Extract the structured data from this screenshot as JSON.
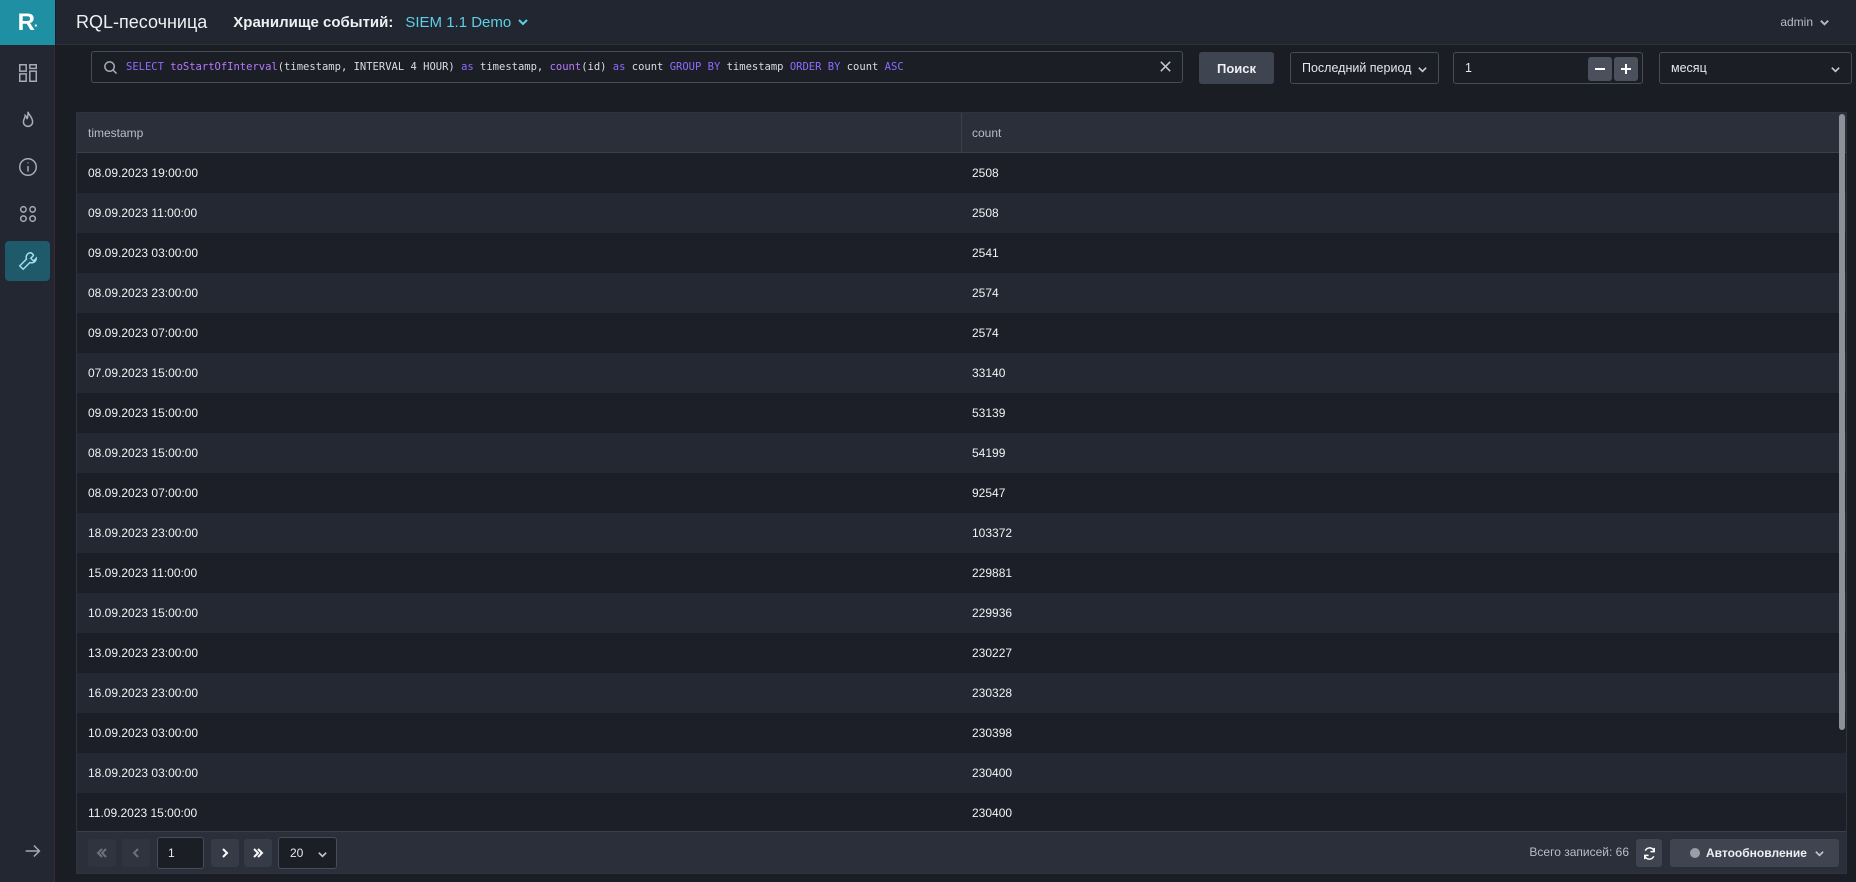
{
  "brand": {
    "logo_letter": "R",
    "logo_dot": "·"
  },
  "header": {
    "title": "RQL-песочница",
    "storage_label": "Хранилище событий:",
    "storage_value": "SIEM 1.1 Demo",
    "user": "admin"
  },
  "sidebar": {
    "items": [
      {
        "icon": "dashboard-icon"
      },
      {
        "icon": "flame-icon"
      },
      {
        "icon": "info-icon"
      },
      {
        "icon": "apps-icon"
      },
      {
        "icon": "wrench-icon",
        "active": true
      }
    ],
    "expand_icon": "arrow-right-icon"
  },
  "toolbar": {
    "query_tokens": [
      {
        "t": "SELECT ",
        "k": "kw"
      },
      {
        "t": "toStartOfInterval",
        "k": "fn"
      },
      {
        "t": "(timestamp, INTERVAL 4 HOUR) ",
        "k": ""
      },
      {
        "t": "as ",
        "k": "kw"
      },
      {
        "t": "timestamp, ",
        "k": ""
      },
      {
        "t": "count",
        "k": "fn"
      },
      {
        "t": "(id) ",
        "k": ""
      },
      {
        "t": "as ",
        "k": "kw"
      },
      {
        "t": "count ",
        "k": ""
      },
      {
        "t": "GROUP BY ",
        "k": "kw"
      },
      {
        "t": "timestamp ",
        "k": ""
      },
      {
        "t": "ORDER BY ",
        "k": "kw"
      },
      {
        "t": "count ",
        "k": ""
      },
      {
        "t": "ASC",
        "k": "kw"
      }
    ],
    "search_button": "Поиск",
    "period_select": "Последний период",
    "period_value": "1",
    "unit_select": "месяц"
  },
  "table": {
    "columns": [
      "timestamp",
      "count"
    ],
    "rows": [
      [
        "08.09.2023 19:00:00",
        "2508"
      ],
      [
        "09.09.2023 11:00:00",
        "2508"
      ],
      [
        "09.09.2023 03:00:00",
        "2541"
      ],
      [
        "08.09.2023 23:00:00",
        "2574"
      ],
      [
        "09.09.2023 07:00:00",
        "2574"
      ],
      [
        "07.09.2023 15:00:00",
        "33140"
      ],
      [
        "09.09.2023 15:00:00",
        "53139"
      ],
      [
        "08.09.2023 15:00:00",
        "54199"
      ],
      [
        "08.09.2023 07:00:00",
        "92547"
      ],
      [
        "18.09.2023 23:00:00",
        "103372"
      ],
      [
        "15.09.2023 11:00:00",
        "229881"
      ],
      [
        "10.09.2023 15:00:00",
        "229936"
      ],
      [
        "13.09.2023 23:00:00",
        "230227"
      ],
      [
        "16.09.2023 23:00:00",
        "230328"
      ],
      [
        "10.09.2023 03:00:00",
        "230398"
      ],
      [
        "18.09.2023 03:00:00",
        "230400"
      ],
      [
        "11.09.2023 15:00:00",
        "230400"
      ]
    ]
  },
  "pagination": {
    "page": "1",
    "per_page": "20",
    "total_text": "Всего записей: 66",
    "auto_refresh_label": "Автообновление"
  },
  "colors": {
    "accent": "#1f8fa3",
    "link": "#5cd0e6",
    "keyword": "#8e6bff"
  }
}
